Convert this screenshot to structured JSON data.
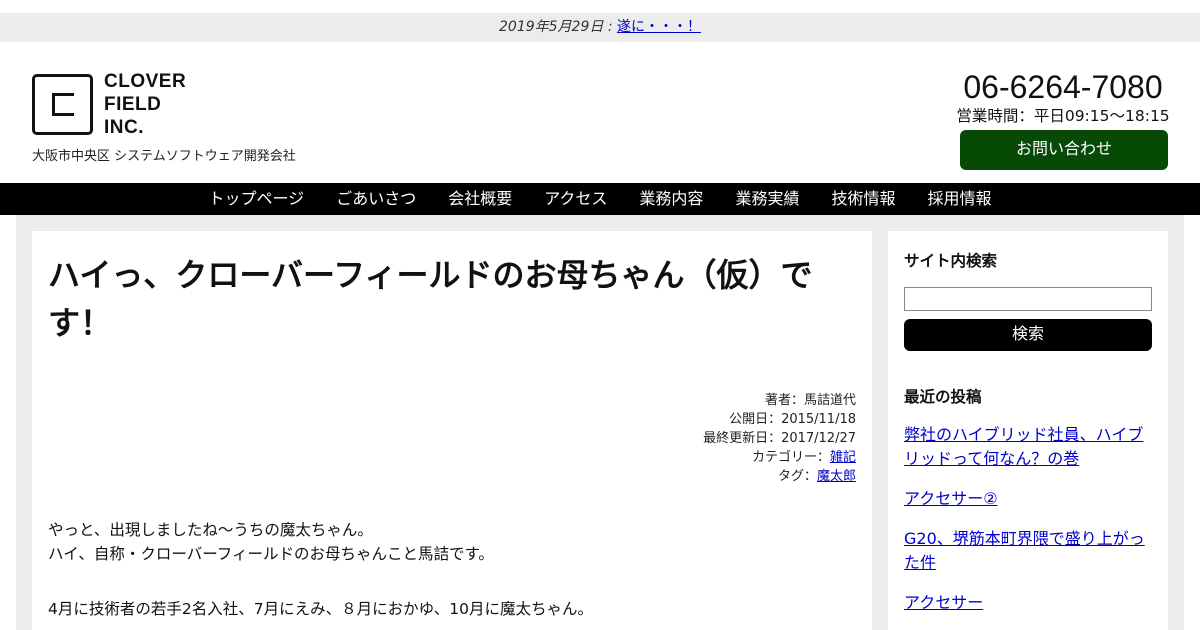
{
  "notice": {
    "date": "2019年5月29日 : ",
    "link": "遂に・・・！"
  },
  "logo": {
    "line1": "CLOVER",
    "line2": "FIELD",
    "line3": "INC."
  },
  "tagline": "大阪市中央区 システムソフトウェア開発会社",
  "contact": {
    "phone": "06-6264-7080",
    "hours": "営業時間：平日09:15〜18:15",
    "inquiry_label": "お問い合わせ"
  },
  "nav": {
    "items": [
      "トップページ",
      "ごあいさつ",
      "会社概要",
      "アクセス",
      "業務内容",
      "業務実績",
      "技術情報",
      "採用情報"
    ]
  },
  "post": {
    "title": "ハイっ、クローバーフィールドのお母ちゃん（仮）です！",
    "author": "著者：馬詰道代",
    "published": "公開日：2015/11/18",
    "updated": "最終更新日：2017/12/27",
    "category_label": "カテゴリー：",
    "category": "雑記",
    "tag_label": "タグ：",
    "tag": "魔太郎",
    "para1_line1": "やっと、出現しましたね〜うちの魔太ちゃん。",
    "para1_line2": "ハイ、自称・クローバーフィールドのお母ちゃんこと馬詰です。",
    "para2_line1": "4月に技術者の若手2名入社、7月にえみ、８月におかゆ、10月に魔太ちゃん。"
  },
  "sidebar": {
    "search_heading": "サイト内検索",
    "search_button": "検索",
    "recent_heading": "最近の投稿",
    "recent_posts": [
      "弊社のハイブリッド社員、ハイブリッドって何なん？の巻",
      "アクセサー②",
      "G20、堺筋本町界隈で盛り上がった件",
      "アクセサー"
    ]
  }
}
